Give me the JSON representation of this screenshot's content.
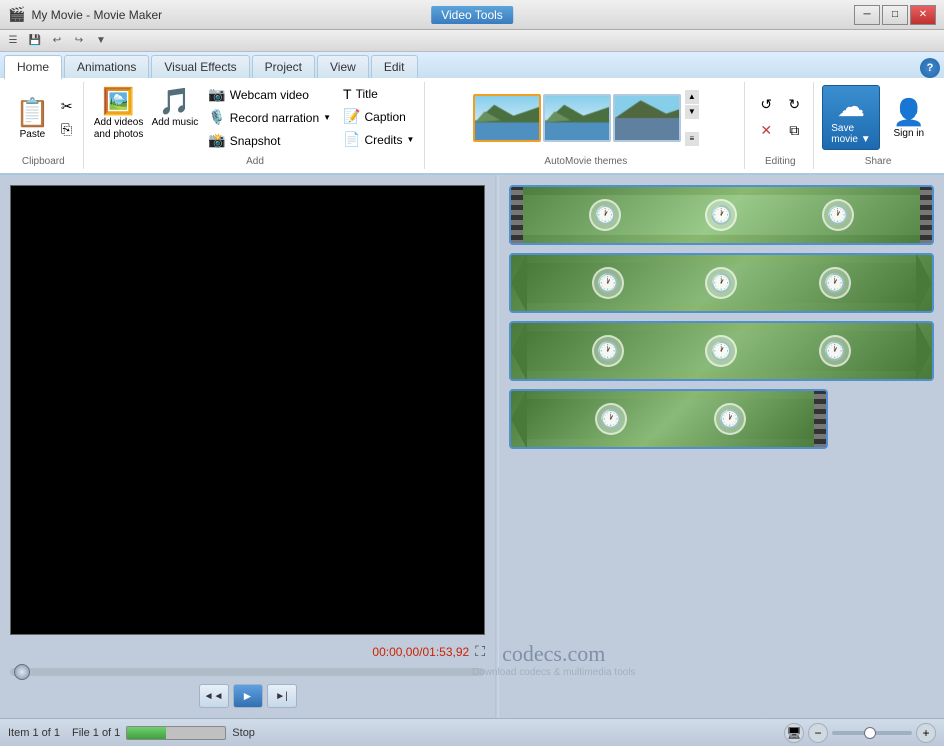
{
  "window": {
    "title": "My Movie - Movie Maker",
    "badge": "Video Tools"
  },
  "titlebar": {
    "minimize": "─",
    "maximize": "□",
    "close": "✕"
  },
  "tabs": {
    "home": "Home",
    "animations": "Animations",
    "visual_effects": "Visual Effects",
    "project": "Project",
    "view": "View",
    "edit": "Edit"
  },
  "groups": {
    "clipboard": "Clipboard",
    "add": "Add",
    "automovie": "AutoMovie themes",
    "editing": "Editing",
    "share": "Share"
  },
  "buttons": {
    "paste": "Paste",
    "cut": "✂",
    "copy": "⎘",
    "add_videos": "Add videos and photos",
    "add_music": "Add music",
    "webcam_video": "Webcam video",
    "record_narration": "Record narration",
    "snapshot": "Snapshot",
    "title": "Title",
    "caption": "Caption",
    "credits": "Credits",
    "save_movie": "Save movie",
    "sign_in": "Sign in",
    "stop": "Stop",
    "help": "?"
  },
  "editing_buttons": {
    "rotate_left": "↺",
    "rotate_right": "↻",
    "trim": "✂",
    "split": "⧉",
    "x": "✕",
    "label": "Editing"
  },
  "player": {
    "time": "00:00,00/01:53,92",
    "prev_frame": "◄◄",
    "play": "►",
    "next_frame": "►|"
  },
  "status": {
    "item": "Item 1 of 1",
    "file": "File 1 of 1",
    "stop": "Stop"
  },
  "watermark": {
    "main": "codecs.com",
    "sub": "Download codecs & multimedia tools"
  },
  "filmstrips": [
    {
      "clocks": 3,
      "type": "full"
    },
    {
      "clocks": 3,
      "type": "full"
    },
    {
      "clocks": 3,
      "type": "full"
    },
    {
      "clocks": 2,
      "type": "partial"
    }
  ]
}
